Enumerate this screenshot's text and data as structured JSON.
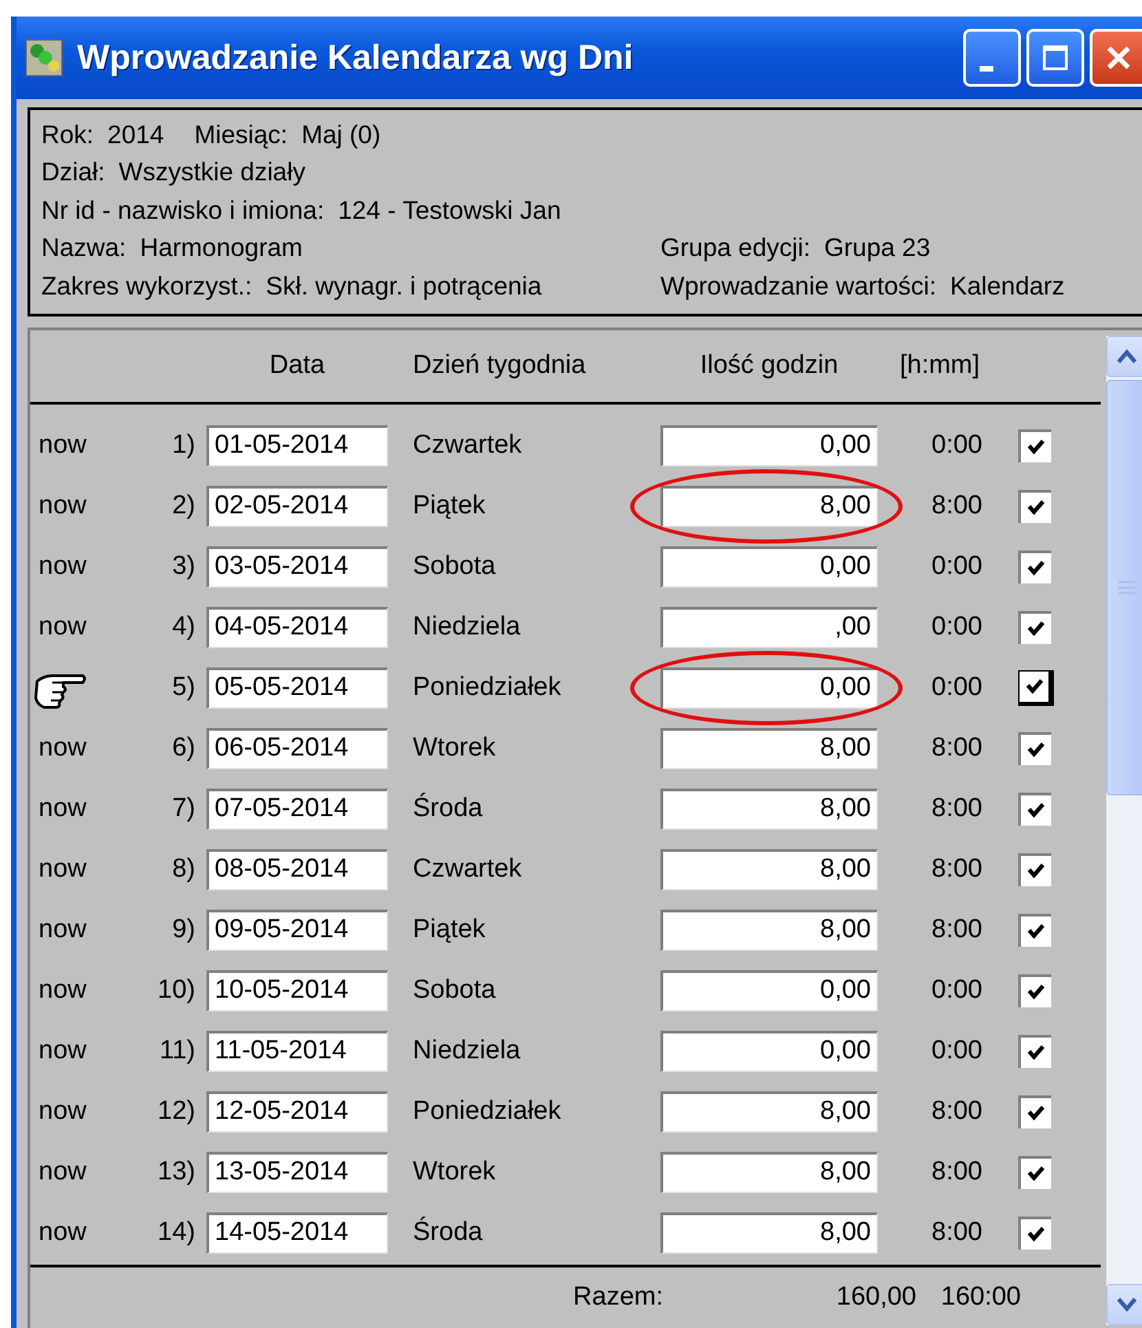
{
  "window": {
    "title": "Wprowadzanie Kalendarza wg Dni"
  },
  "info": [
    {
      "items": [
        {
          "label": "Rok:",
          "value": "2014"
        },
        {
          "label": "Miesiąc:",
          "value": "Maj (0)"
        }
      ]
    },
    {
      "items": [
        {
          "label": "Dział:",
          "value": "Wszystkie działy"
        }
      ]
    },
    {
      "items": [
        {
          "label": "Nr id - nazwisko i imiona:",
          "value": "124 - Testowski Jan"
        }
      ]
    },
    {
      "items": [
        {
          "label": "Nazwa:",
          "value": "Harmonogram"
        }
      ],
      "side": [
        {
          "label": "Grupa edycji:",
          "value": "Grupa 23"
        }
      ]
    },
    {
      "items": [
        {
          "label": "Zakres wykorzyst.:",
          "value": "Skł. wynagr. i potrącenia"
        }
      ],
      "side": [
        {
          "label": "Wprowadzanie wartości:",
          "value": "Kalendarz"
        }
      ]
    }
  ],
  "table": {
    "columns": [
      "Data",
      "Dzień tygodnia",
      "Ilość godzin",
      "[h:mm]"
    ],
    "rows": [
      {
        "marker": {
          "kind": "text",
          "label": "now"
        },
        "number": "1)",
        "date": "01-05-2014",
        "day": "Czwartek",
        "hours": "0,00",
        "hmm": "0:00",
        "checked": true,
        "focused": false,
        "highlighted": false
      },
      {
        "marker": {
          "kind": "text",
          "label": "now"
        },
        "number": "2)",
        "date": "02-05-2014",
        "day": "Piątek",
        "hours": "8,00",
        "hmm": "8:00",
        "checked": true,
        "focused": false,
        "highlighted": true
      },
      {
        "marker": {
          "kind": "text",
          "label": "now"
        },
        "number": "3)",
        "date": "03-05-2014",
        "day": "Sobota",
        "hours": "0,00",
        "hmm": "0:00",
        "checked": true,
        "focused": false,
        "highlighted": false
      },
      {
        "marker": {
          "kind": "text",
          "label": "now"
        },
        "number": "4)",
        "date": "04-05-2014",
        "day": "Niedziela",
        "hours": ",00",
        "hmm": "0:00",
        "checked": true,
        "focused": false,
        "highlighted": false
      },
      {
        "marker": {
          "kind": "pointer"
        },
        "number": "5)",
        "date": "05-05-2014",
        "day": "Poniedziałek",
        "hours": "0,00",
        "hmm": "0:00",
        "checked": true,
        "focused": true,
        "highlighted": true
      },
      {
        "marker": {
          "kind": "text",
          "label": "now"
        },
        "number": "6)",
        "date": "06-05-2014",
        "day": "Wtorek",
        "hours": "8,00",
        "hmm": "8:00",
        "checked": true,
        "focused": false,
        "highlighted": false
      },
      {
        "marker": {
          "kind": "text",
          "label": "now"
        },
        "number": "7)",
        "date": "07-05-2014",
        "day": "Środa",
        "hours": "8,00",
        "hmm": "8:00",
        "checked": true,
        "focused": false,
        "highlighted": false
      },
      {
        "marker": {
          "kind": "text",
          "label": "now"
        },
        "number": "8)",
        "date": "08-05-2014",
        "day": "Czwartek",
        "hours": "8,00",
        "hmm": "8:00",
        "checked": true,
        "focused": false,
        "highlighted": false
      },
      {
        "marker": {
          "kind": "text",
          "label": "now"
        },
        "number": "9)",
        "date": "09-05-2014",
        "day": "Piątek",
        "hours": "8,00",
        "hmm": "8:00",
        "checked": true,
        "focused": false,
        "highlighted": false
      },
      {
        "marker": {
          "kind": "text",
          "label": "now"
        },
        "number": "10)",
        "date": "10-05-2014",
        "day": "Sobota",
        "hours": "0,00",
        "hmm": "0:00",
        "checked": true,
        "focused": false,
        "highlighted": false
      },
      {
        "marker": {
          "kind": "text",
          "label": "now"
        },
        "number": "11)",
        "date": "11-05-2014",
        "day": "Niedziela",
        "hours": "0,00",
        "hmm": "0:00",
        "checked": true,
        "focused": false,
        "highlighted": false
      },
      {
        "marker": {
          "kind": "text",
          "label": "now"
        },
        "number": "12)",
        "date": "12-05-2014",
        "day": "Poniedziałek",
        "hours": "8,00",
        "hmm": "8:00",
        "checked": true,
        "focused": false,
        "highlighted": false
      },
      {
        "marker": {
          "kind": "text",
          "label": "now"
        },
        "number": "13)",
        "date": "13-05-2014",
        "day": "Wtorek",
        "hours": "8,00",
        "hmm": "8:00",
        "checked": true,
        "focused": false,
        "highlighted": false
      },
      {
        "marker": {
          "kind": "text",
          "label": "now"
        },
        "number": "14)",
        "date": "14-05-2014",
        "day": "Środa",
        "hours": "8,00",
        "hmm": "8:00",
        "checked": true,
        "focused": false,
        "highlighted": false
      }
    ],
    "total": {
      "label": "Razem:",
      "hours": "160,00",
      "hmm": "160:00"
    }
  }
}
